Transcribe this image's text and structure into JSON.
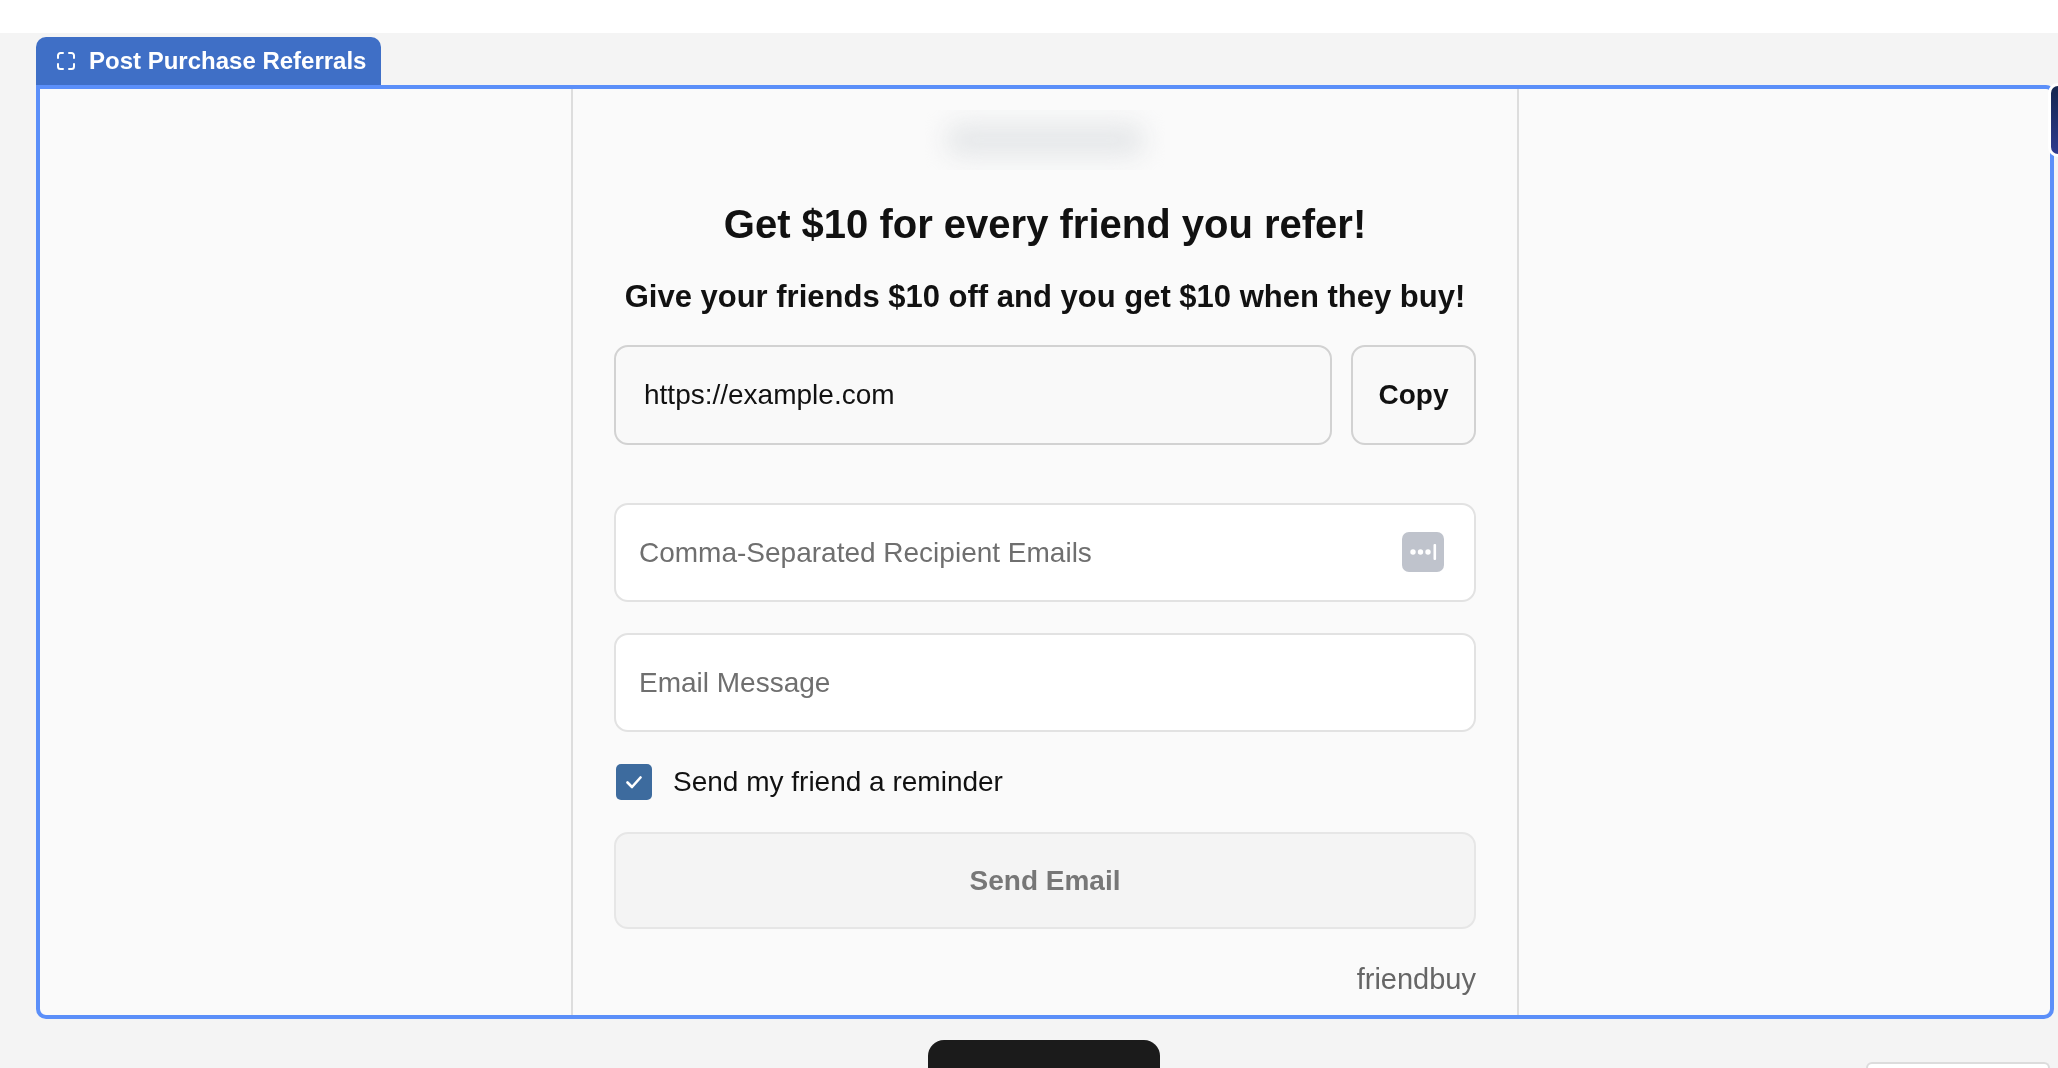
{
  "tab": {
    "label": "Post Purchase Referrals"
  },
  "widget": {
    "heading": "Get $10 for every friend you refer!",
    "subheading": "Give your friends $10 off and you get $10 when they buy!",
    "share_link": {
      "value": "https://example.com",
      "button": "Copy"
    },
    "recipients_field": {
      "placeholder": "Comma-Separated Recipient Emails"
    },
    "message_field": {
      "placeholder": "Email Message"
    },
    "reminder": {
      "label": "Send my friend a reminder",
      "checked": true
    },
    "send_button": {
      "label": "Send Email",
      "disabled": true
    },
    "branding": "friendbuy"
  }
}
